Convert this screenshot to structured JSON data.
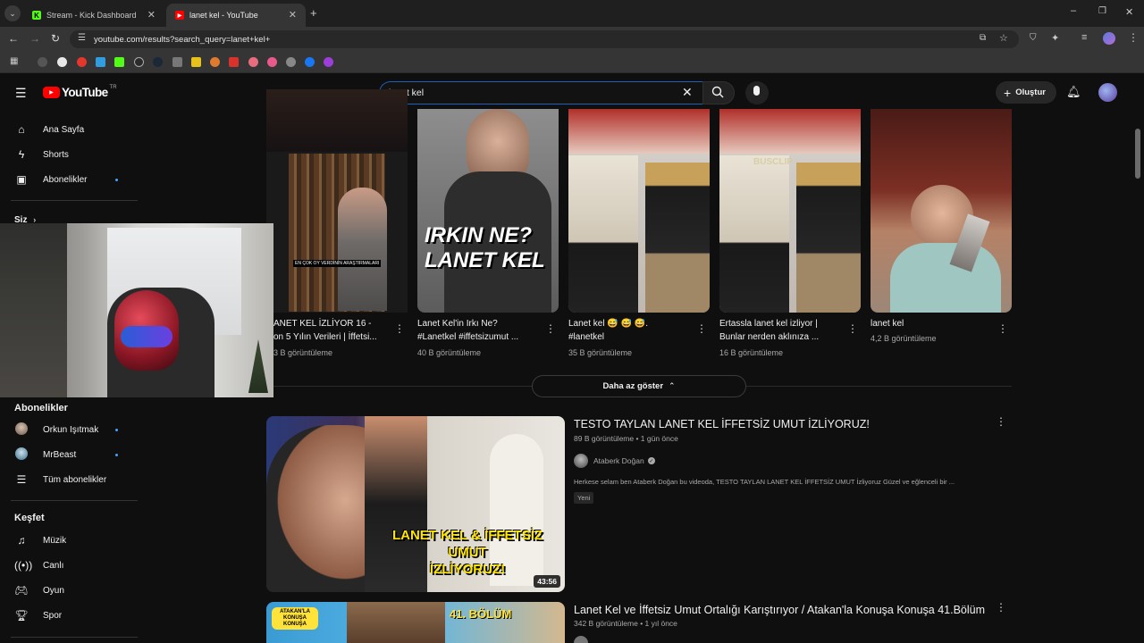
{
  "browser": {
    "tabs": [
      {
        "title": "Stream - Kick Dashboard",
        "icon": "kick-icon"
      },
      {
        "title": "lanet kel - YouTube",
        "icon": "youtube-icon"
      }
    ],
    "url": "youtube.com/results?search_query=lanet+kel+",
    "colors": {
      "kick": "#53fc18",
      "youtube": "#ff0000"
    }
  },
  "youtube": {
    "logo_text": "YouTube",
    "logo_sup": "TR",
    "search_value": "lanet kel",
    "create_label": "Oluştur",
    "sidebar": {
      "main": [
        {
          "label": "Ana Sayfa",
          "icon": "home-icon"
        },
        {
          "label": "Shorts",
          "icon": "shorts-icon"
        },
        {
          "label": "Abonelikler",
          "icon": "subscriptions-icon"
        }
      ],
      "you_label": "Siz",
      "subs_title": "Abonelikler",
      "subs": [
        {
          "label": "Orkun Işıtmak"
        },
        {
          "label": "MrBeast"
        },
        {
          "label": "Tüm abonelikler"
        }
      ],
      "explore_title": "Keşfet",
      "explore": [
        {
          "label": "Müzik",
          "icon": "music-icon"
        },
        {
          "label": "Canlı",
          "icon": "live-icon"
        },
        {
          "label": "Oyun",
          "icon": "gaming-icon"
        },
        {
          "label": "Spor",
          "icon": "trophy-icon"
        }
      ]
    },
    "shorts": [
      {
        "title_line1": "ANET KEL İZLİYOR 16 -",
        "title_line2": "on 5 Yılın Verileri | İffetsi...",
        "views": "3 B görüntüleme",
        "overlay": "EN ÇOK OY VERDİNİN ARAŞTIRMALARI"
      },
      {
        "title_line1": "Lanet Kel'in Irkı Ne?",
        "title_line2": "#Lanetkel #iffetsizumut ...",
        "views": "40 B görüntüleme",
        "overlay": "IRKIN NE? LANET KEL"
      },
      {
        "title_line1": "Lanet kel 😅 😅 😅.",
        "title_line2": "#lanetkel",
        "views": "35 B görüntüleme"
      },
      {
        "title_line1": "Ertassla lanet kel izliyor |",
        "title_line2": "Bunlar nerden aklınıza ...",
        "views": "16 B görüntüleme",
        "overlay": "BUSCLIP"
      },
      {
        "title_line1": "lanet kel",
        "title_line2": "",
        "views": "4,2 B görüntüleme"
      }
    ],
    "show_less": "Daha az göster",
    "videos": [
      {
        "title": "TESTO TAYLAN LANET KEL İFFETSİZ UMUT İZLİYORUZ!",
        "meta": "89 B görüntüleme • 1 gün önce",
        "channel": "Ataberk Doğan",
        "description": "Herkese selam ben Ataberk Doğan bu videoda, TESTO TAYLAN LANET KEL İFFETSİZ UMUT İzliyoruz Güzel ve eğlenceli bir ...",
        "badge": "Yeni",
        "duration": "43:56",
        "thumb_text_1": "LANET KEL & İFFETSİZ",
        "thumb_text_2": "UMUT",
        "thumb_text_3": "İZLİYORUZ!"
      },
      {
        "title": "Lanet Kel ve İffetsiz Umut Ortalığı Karıştırıyor / Atakan'la Konuşa Konuşa 41.Bölüm",
        "meta": "342 B görüntüleme • 1 yıl önce",
        "thumb_badge": "ATAKAN'LA KONUŞA KONUŞA",
        "thumb_episode": "41. BÖLÜM"
      }
    ]
  }
}
